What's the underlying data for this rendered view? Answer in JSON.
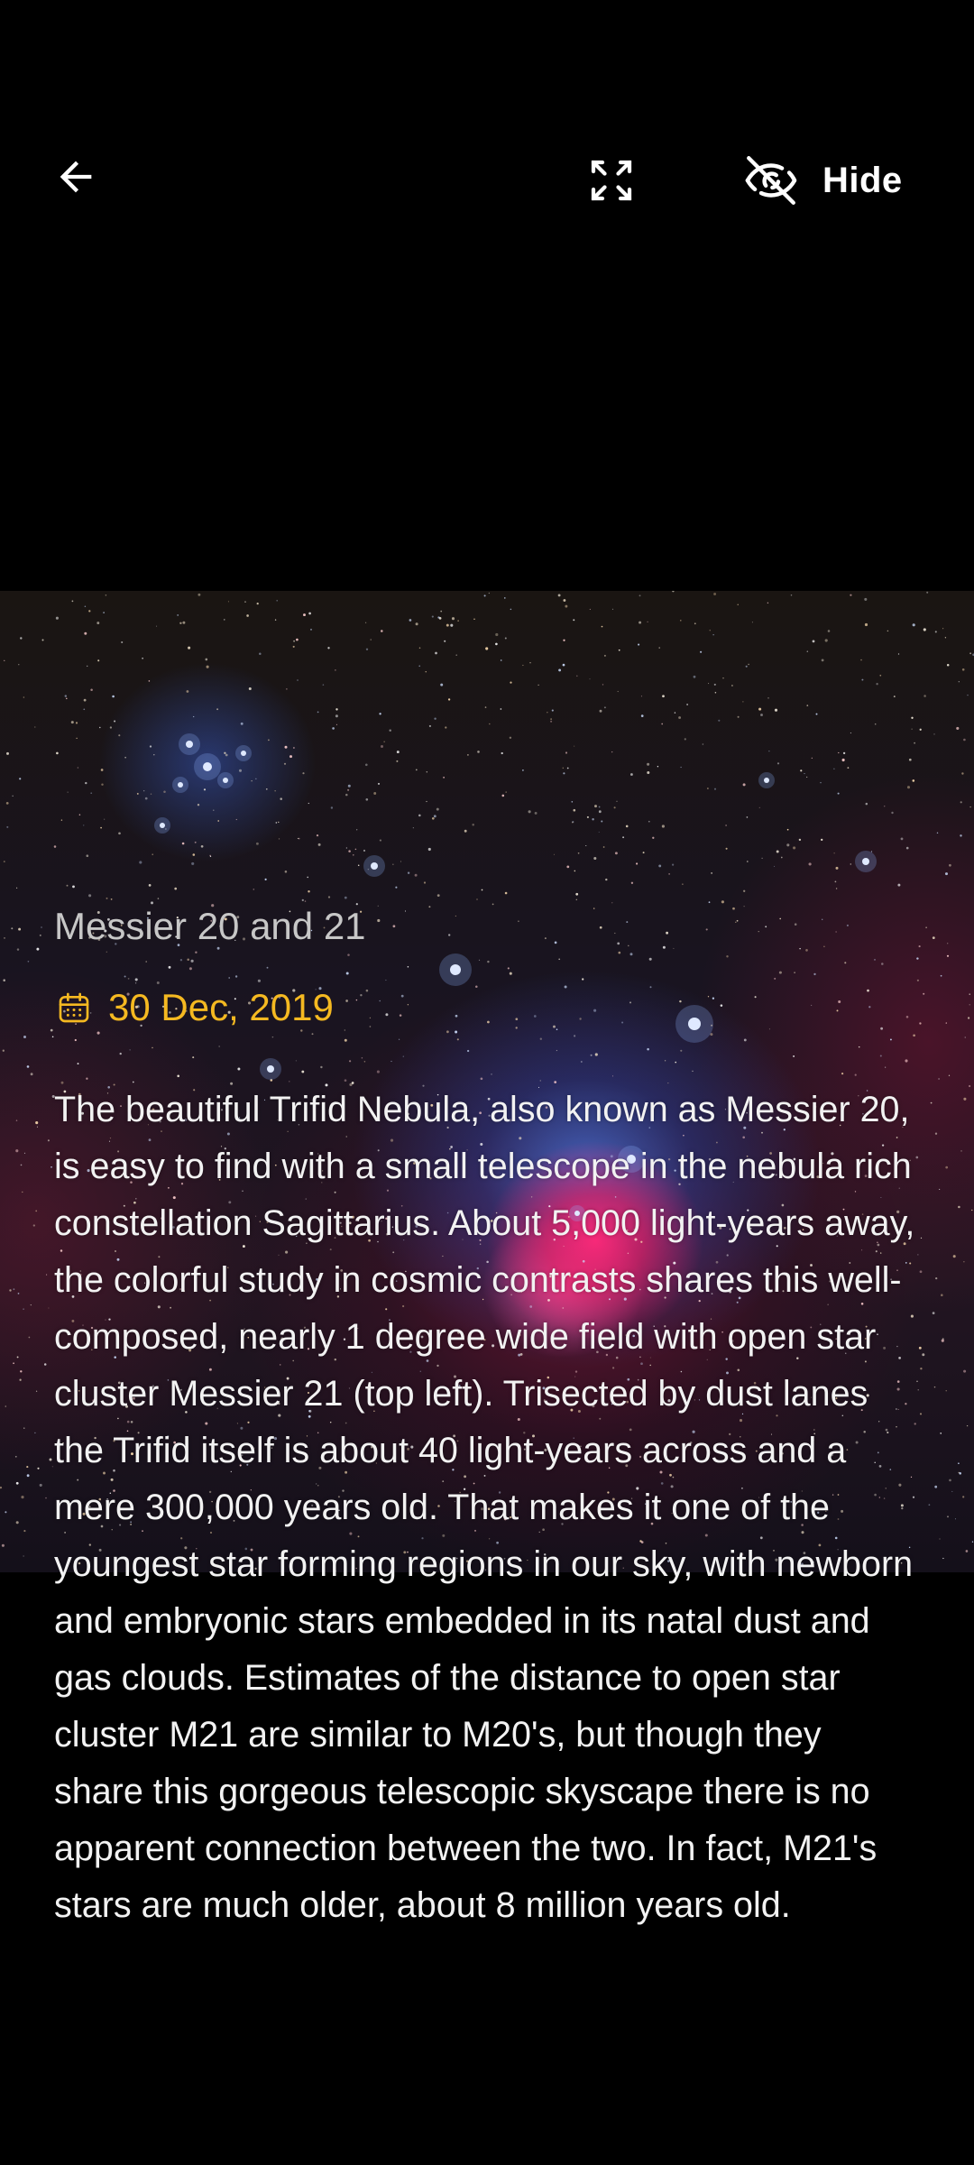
{
  "toolbar": {
    "back_icon": "arrow-back-icon",
    "fullscreen_icon": "fullscreen-icon",
    "hide_icon": "eye-off-icon",
    "hide_label": "Hide"
  },
  "image": {
    "subject": "nebula-photo"
  },
  "apod": {
    "title": "Messier 20 and 21",
    "date_icon": "calendar-icon",
    "date": "30 Dec, 2019",
    "explanation": "The beautiful Trifid Nebula, also known as Messier 20, is easy to find with a small telescope in the nebula rich constellation Sagittarius. About 5,000 light-years away, the colorful study in cosmic contrasts shares this well-composed, nearly 1 degree wide field with open star cluster Messier 21 (top left). Trisected by dust lanes the Trifid itself is about 40 light-years across and a mere 300,000 years old. That makes it one of the youngest star forming regions in our sky, with newborn and embryonic stars embedded in its natal dust and gas clouds. Estimates of the distance to open star cluster M21 are similar to M20's, but though they share this gorgeous telescopic skyscape there is no apparent connection between the two. In fact, M21's stars are much older, about 8 million years old."
  },
  "colors": {
    "background": "#000000",
    "accent_date": "#f5b921",
    "title_text": "#c7c7c7",
    "body_text": "#f2f2f2"
  }
}
